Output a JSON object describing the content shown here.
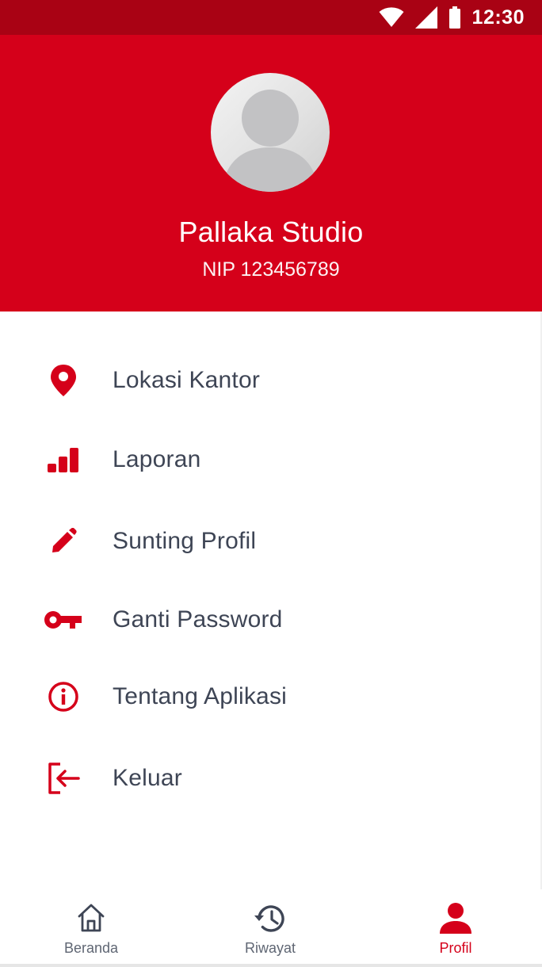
{
  "status_bar": {
    "time": "12:30",
    "icons": [
      "wifi-icon",
      "cellular-signal-icon",
      "battery-icon"
    ]
  },
  "profile": {
    "name": "Pallaka Studio",
    "nip": "NIP 123456789",
    "avatar_icon": "default-avatar-icon"
  },
  "menu": {
    "items": [
      {
        "label": "Lokasi Kantor",
        "icon": "location-pin-icon"
      },
      {
        "label": "Laporan",
        "icon": "bar-chart-icon"
      },
      {
        "label": "Sunting Profil",
        "icon": "pencil-icon"
      },
      {
        "label": "Ganti Password",
        "icon": "key-icon"
      },
      {
        "label": "Tentang Aplikasi",
        "icon": "info-icon"
      },
      {
        "label": "Keluar",
        "icon": "logout-icon"
      }
    ]
  },
  "bottom_nav": {
    "tabs": [
      {
        "label": "Beranda",
        "icon": "home-icon",
        "active": false
      },
      {
        "label": "Riwayat",
        "icon": "history-icon",
        "active": false
      },
      {
        "label": "Profil",
        "icon": "person-icon",
        "active": true
      }
    ]
  },
  "colors": {
    "primary": "#d5001a",
    "status_bar": "#a90214",
    "text": "#3e4555",
    "nav_inactive": "#5f6673"
  }
}
